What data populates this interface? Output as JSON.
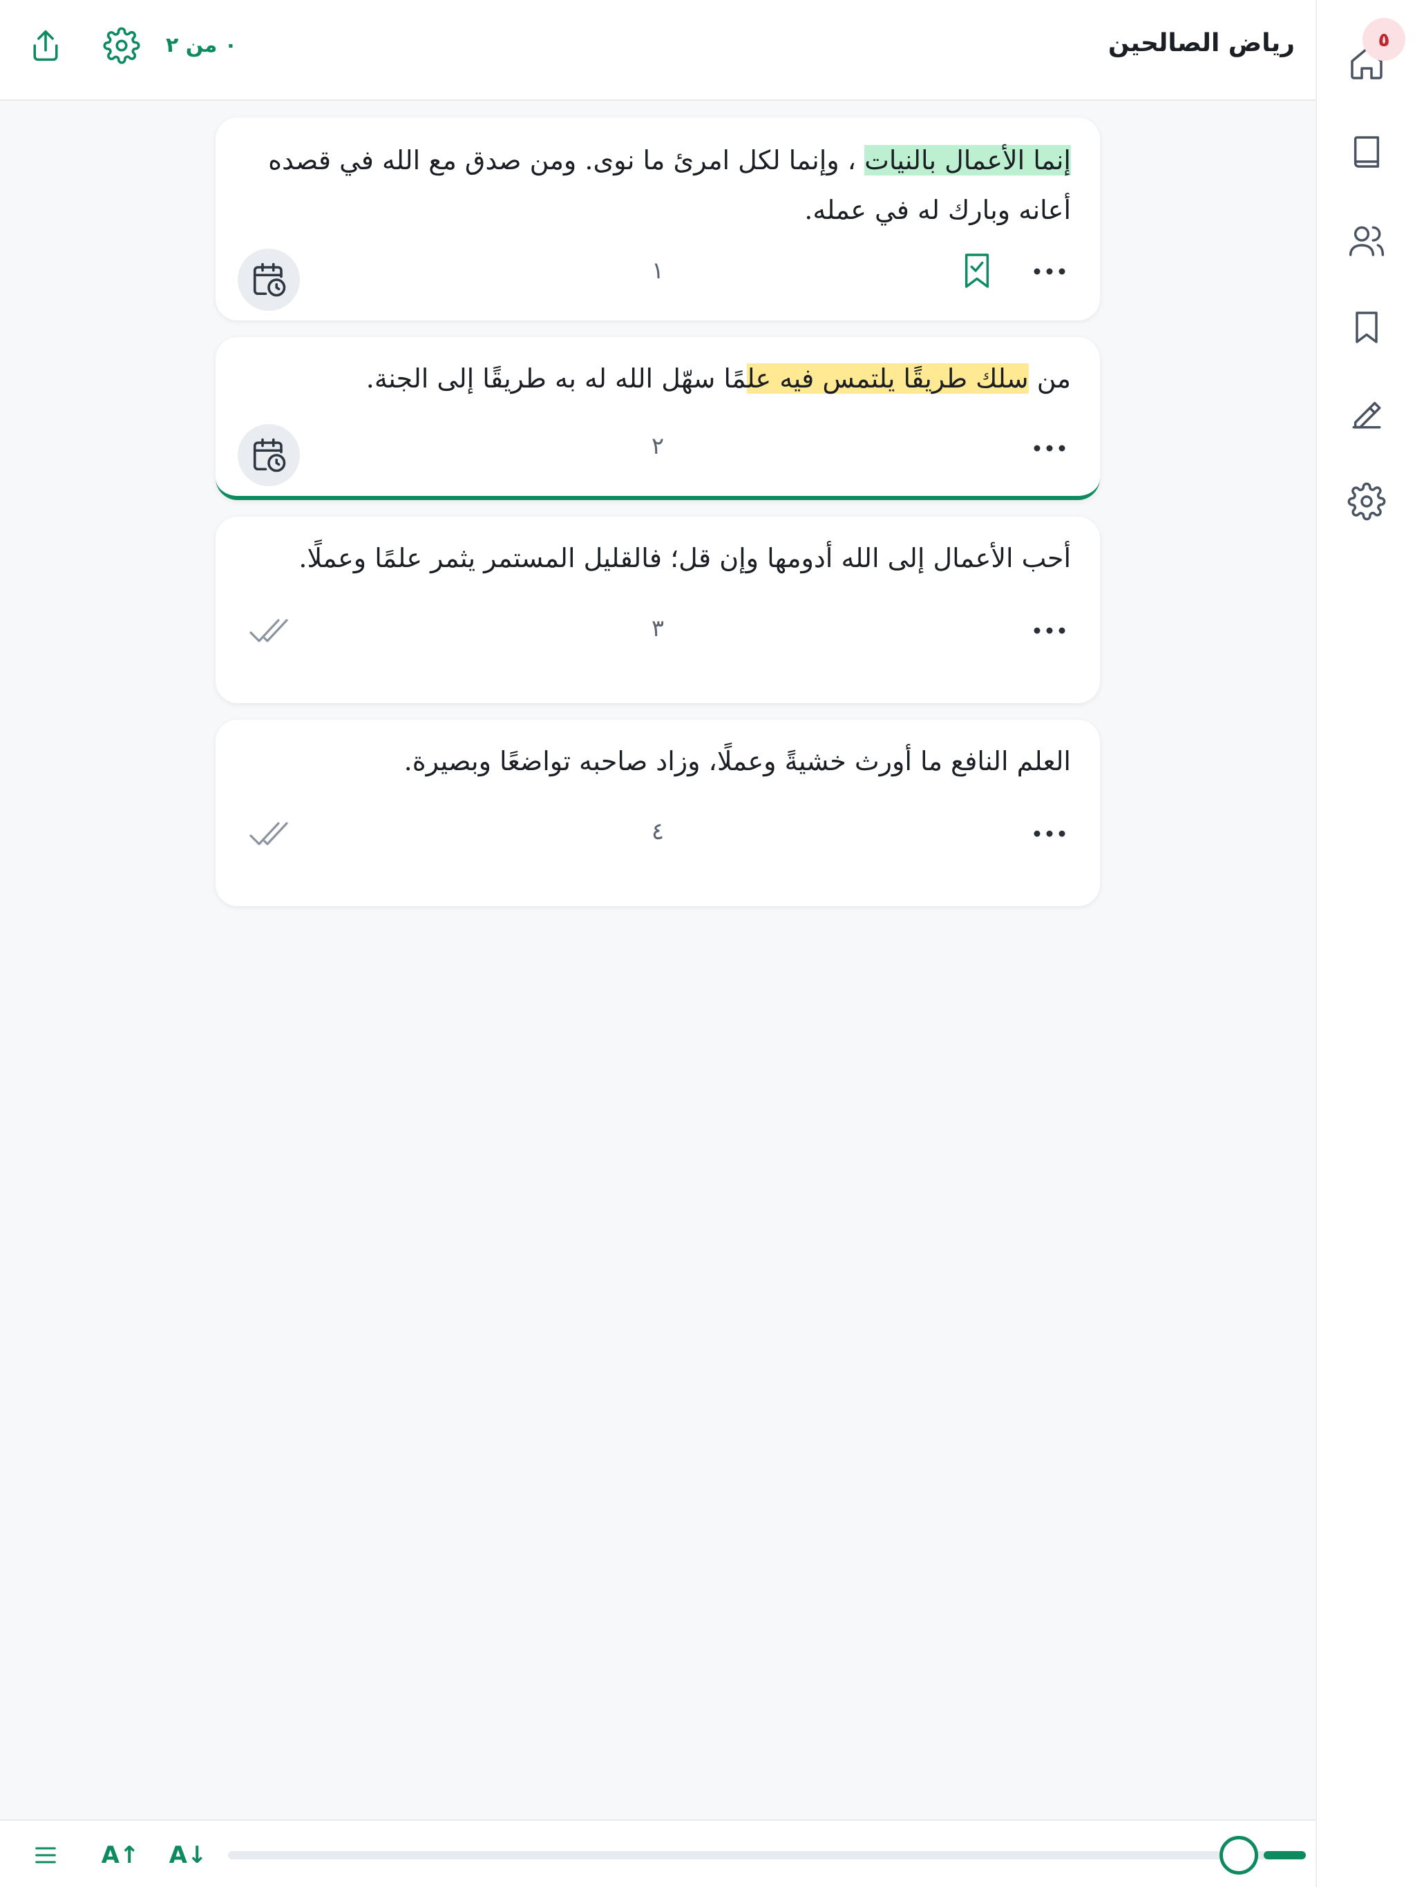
{
  "app": {
    "title": "رياض الصالحين",
    "progress_label": "٠ من ٢",
    "accent_color": "#0e8a5f"
  },
  "sidebar": {
    "badge_count": "٥",
    "items": [
      {
        "name": "home",
        "icon": "home-icon"
      },
      {
        "name": "book",
        "icon": "book-icon"
      },
      {
        "name": "users",
        "icon": "users-icon"
      },
      {
        "name": "bookmark",
        "icon": "bookmark-icon"
      },
      {
        "name": "highlighter",
        "icon": "highlighter-icon"
      },
      {
        "name": "settings",
        "icon": "gear-icon"
      }
    ]
  },
  "header": {
    "icons": [
      "share-icon",
      "gear-icon"
    ]
  },
  "cards": [
    {
      "highlight": "إنما الأعمال بالنيات",
      "highlight_color": "green",
      "text_rest": "، وإنما لكل امرئ ما نوى. ومن صدق مع الله في قصده أعانه وبارك له في عمله.",
      "number": "١",
      "action": "schedule",
      "bookmarked": true
    },
    {
      "text_prefix": "من ",
      "highlight": "سلك طريقًا يلتمس فيه عل",
      "highlight_color": "yellow",
      "text_rest": "مًا سهّل الله له به طريقًا إلى الجنة.",
      "number": "٢",
      "action": "schedule",
      "bookmarked": false,
      "active": true
    },
    {
      "text_rest": "أحب الأعمال إلى الله أدومها وإن قل؛ فالقليل المستمر يثمر علمًا وعملًا.",
      "number": "٣",
      "action": "done",
      "bookmarked": false
    },
    {
      "text_rest": "العلم النافع ما أورث خشيةً وعملًا، وزاد صاحبه تواضعًا وبصيرة.",
      "number": "٤",
      "action": "done",
      "bookmarked": false
    }
  ],
  "bottom_bar": {
    "font_increase_label": "A↑",
    "font_decrease_label": "A↓",
    "slider_value": 0.02
  }
}
